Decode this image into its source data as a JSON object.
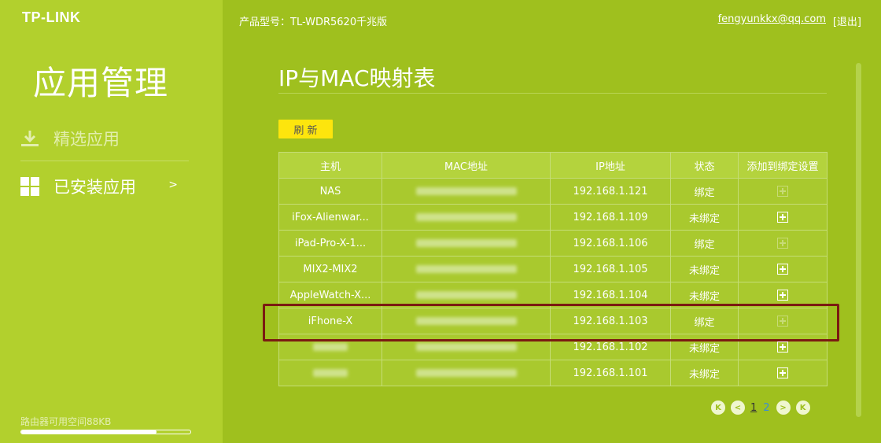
{
  "sidebar": {
    "logo": "TP-LINK",
    "heading": "应用管理",
    "items": [
      {
        "label": "精选应用",
        "icon": "download-icon"
      },
      {
        "label": "已安装应用",
        "icon": "grid-icon",
        "chevron": ">"
      }
    ],
    "storage_text": "路由器可用空间88KB",
    "storage_fraction": 0.8
  },
  "header": {
    "model": "产品型号：TL-WDR5620千兆版",
    "account": "fengyunkkx@qq.com",
    "logout": "[退出]"
  },
  "main": {
    "title": "IP与MAC映射表",
    "refresh_label": "刷 新",
    "columns": [
      "主机",
      "MAC地址",
      "IP地址",
      "状态",
      "添加到绑定设置"
    ],
    "rows": [
      {
        "host": "NAS",
        "mac_blurred": true,
        "ip": "192.168.1.121",
        "status": "绑定",
        "add_enabled": false
      },
      {
        "host": "iFox-Alienwar...",
        "mac_blurred": true,
        "ip": "192.168.1.109",
        "status": "未绑定",
        "add_enabled": true
      },
      {
        "host": "iPad-Pro-X-1...",
        "mac_blurred": true,
        "ip": "192.168.1.106",
        "status": "绑定",
        "add_enabled": false
      },
      {
        "host": "MIX2-MIX2",
        "mac_blurred": true,
        "ip": "192.168.1.105",
        "status": "未绑定",
        "add_enabled": true
      },
      {
        "host": "AppleWatch-X...",
        "mac_blurred": true,
        "ip": "192.168.1.104",
        "status": "未绑定",
        "add_enabled": true
      },
      {
        "host": "iFhone-X",
        "mac_blurred": true,
        "ip": "192.168.1.103",
        "status": "绑定",
        "add_enabled": false
      },
      {
        "host": "",
        "host_blurred": true,
        "mac_blurred": true,
        "ip": "192.168.1.102",
        "status": "未绑定",
        "add_enabled": true
      },
      {
        "host": "",
        "host_blurred": true,
        "mac_blurred": true,
        "ip": "192.168.1.101",
        "status": "未绑定",
        "add_enabled": true
      }
    ],
    "pager": {
      "first": "K",
      "prev": "<",
      "pages": [
        "1",
        "2"
      ],
      "current": "1",
      "next": ">",
      "last": "K"
    }
  },
  "colors": {
    "background": "#9fc01e",
    "sidebar": "#b2d02d",
    "refresh": "#fde50d",
    "highlight": "#7b1b12"
  }
}
